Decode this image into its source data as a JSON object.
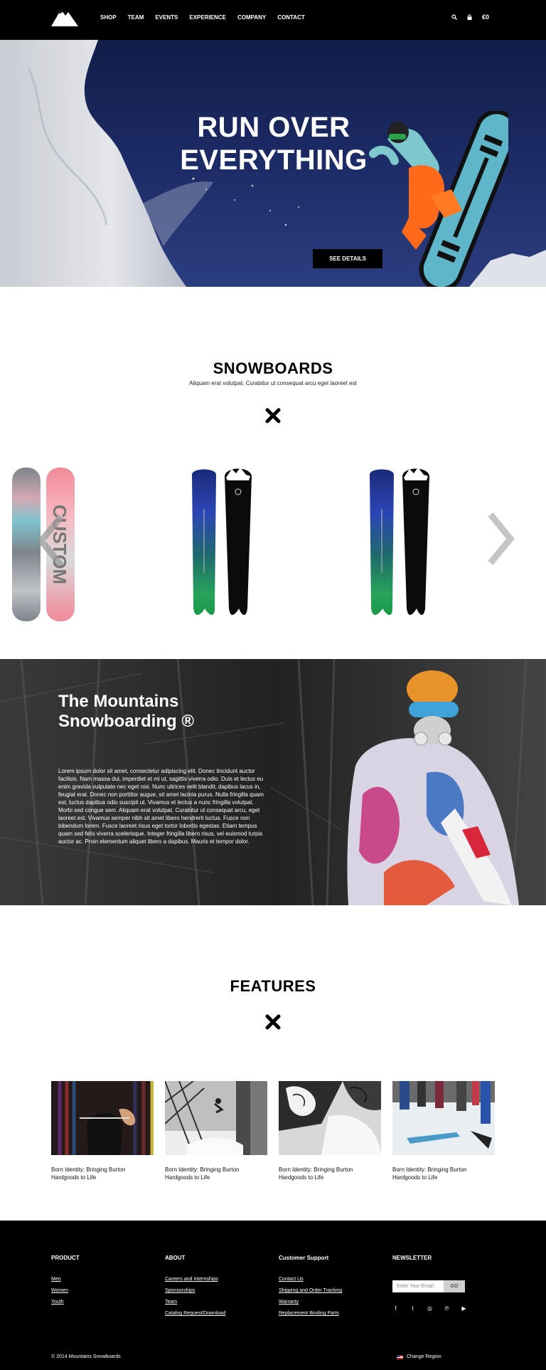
{
  "header": {
    "nav": [
      "SHOP",
      "TEAM",
      "EVENTS",
      "EXPERIENCE",
      "COMPANY",
      "CONTACT"
    ],
    "cart_label": "€0",
    "search_icon": "search-icon",
    "lock_icon": "lock-icon"
  },
  "hero": {
    "title_line1": "RUN OVER",
    "title_line2": "EVERYTHING",
    "button": "SEE DETAILS"
  },
  "snowboards": {
    "title": "SNOWBOARDS",
    "subtitle": "Aliquam erat volutpat. Curabitur ut consequat arcu eget laoreet est",
    "board_brand_text": "CUSTOM"
  },
  "banner": {
    "title_line1": "The Mountains",
    "title_line2": "Snowboarding ®",
    "body": "Lorem ipsum dolor sit amet, consectetur adipiscing elit. Donec tincidunt auctor facilisis. Nam massa dui, imperdiet et mi ut, sagittis viverra odio. Duis et lectus eu enim gravida vulputate nec eget nisi. Nunc ultrices velit blandit, dapibus lacus in, feugiat erat. Donec non porttitor augue, sit amet lacinia purus. Nulla fringilla quam est, luctus dapibus odio suscipit ut. Vivamus et lectus a nunc fringilla volutpat. Morbi sed congue sem. Aliquam erat volutpat. Curabitur ut consequat arcu, eget laoreet est. Vivamus semper nibh sit amet libero hendrerit luctus. Fusce non bibendum lorem. Fusce laoreet risus eget tortor lobortis egestas. Etiam tempus quam sed felis viverra scelerisque. Integer fringilla libero risus, vel euismod turpis auctor ac. Proin elementum aliquet libero a dapibus. Mauris et tempor dolor."
  },
  "features": {
    "title": "FEATURES",
    "cards": [
      {
        "caption": "Born Identity: Bringing Burton Hardgoods to Life"
      },
      {
        "caption": "Born Identity: Bringing Burton Hardgoods to Life"
      },
      {
        "caption": "Born Identity: Bringing Burton Hardgoods to Life"
      },
      {
        "caption": "Born Identity: Bringing Burton Hardgoods to Life"
      }
    ]
  },
  "footer": {
    "product": {
      "heading": "PRODUCT",
      "links": [
        "Men",
        "Women",
        "Youth"
      ]
    },
    "about": {
      "heading": "ABOUT",
      "links": [
        "Careers and Internships",
        "Sponsorships",
        "Team",
        "Catalog Request/Download"
      ]
    },
    "support": {
      "heading": "Customer Support",
      "links": [
        "Contact Us",
        "Shipping and Order Tracking",
        "Warranty",
        "Replacement Binding Parts"
      ]
    },
    "newsletter": {
      "heading": "NEWSLETTER",
      "placeholder": "Enter Your Email",
      "button": "GO"
    },
    "socials": [
      "f",
      "t",
      "◎",
      "℗",
      "▶"
    ],
    "social_icons": [
      "facebook-icon",
      "twitter-icon",
      "instagram-icon",
      "pinterest-icon",
      "youtube-icon"
    ],
    "copyright": "© 2014 Mountains Snowboards",
    "region": "Change Region"
  },
  "colors": {
    "black": "#000000",
    "hero_sky": "#1b2a63",
    "accent_orange": "#ff6a1a"
  }
}
